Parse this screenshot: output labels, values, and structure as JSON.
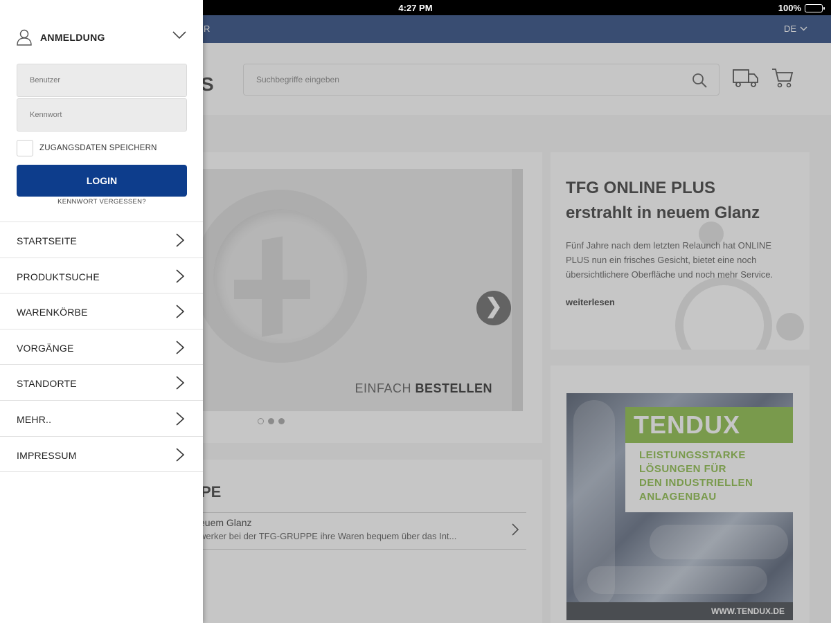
{
  "status": {
    "time": "4:27 PM",
    "battery": "100%"
  },
  "topbar": {
    "partial_text": "R",
    "language": "DE"
  },
  "header": {
    "logo_partial": "S",
    "search_placeholder": "Suchbegriffe eingeben"
  },
  "slider": {
    "caption_light": "EINFACH ",
    "caption_bold": "BESTELLEN",
    "next_glyph": "❯"
  },
  "news": {
    "title_line1": "TFG ONLINE PLUS",
    "title_line2": "erstrahlt in neuem Glanz",
    "body": "Fünf Jahre nach dem letzten Relaunch hat ONLINE PLUS nun ein frisches Gesicht, bietet eine noch übersichtlichere Oberfläche und noch mehr Service.",
    "more": "weiterlesen"
  },
  "group": {
    "heading_partial": "PE",
    "item_title": "euem Glanz",
    "item_text": "werker bei der TFG-GRUPPE ihre Waren bequem über das Int..."
  },
  "ad": {
    "brand": "TENDUX",
    "tagline": [
      "LEISTUNGSSTARKE",
      "LÖSUNGEN FÜR",
      "DEN INDUSTRIELLEN",
      "ANLAGENBAU"
    ],
    "url": "WWW.TENDUX.DE",
    "brand_color": "#7ab32e"
  },
  "drawer": {
    "login_title": "ANMELDUNG",
    "user_placeholder": "Benutzer",
    "password_placeholder": "Kennwort",
    "remember_label": "ZUGANGSDATEN SPEICHERN",
    "login_button": "LOGIN",
    "forgot_link": "KENNWORT VERGESSEN?",
    "menu": [
      {
        "label": "STARTSEITE"
      },
      {
        "label": "PRODUKTSUCHE"
      },
      {
        "label": "WARENKÖRBE"
      },
      {
        "label": "VORGÄNGE"
      },
      {
        "label": "STANDORTE"
      },
      {
        "label": "MEHR.."
      },
      {
        "label": "IMPRESSUM"
      }
    ]
  },
  "colors": {
    "primary": "#0d3d8c",
    "topbar": "#0d2f6e",
    "accent": "#7ab32e"
  }
}
